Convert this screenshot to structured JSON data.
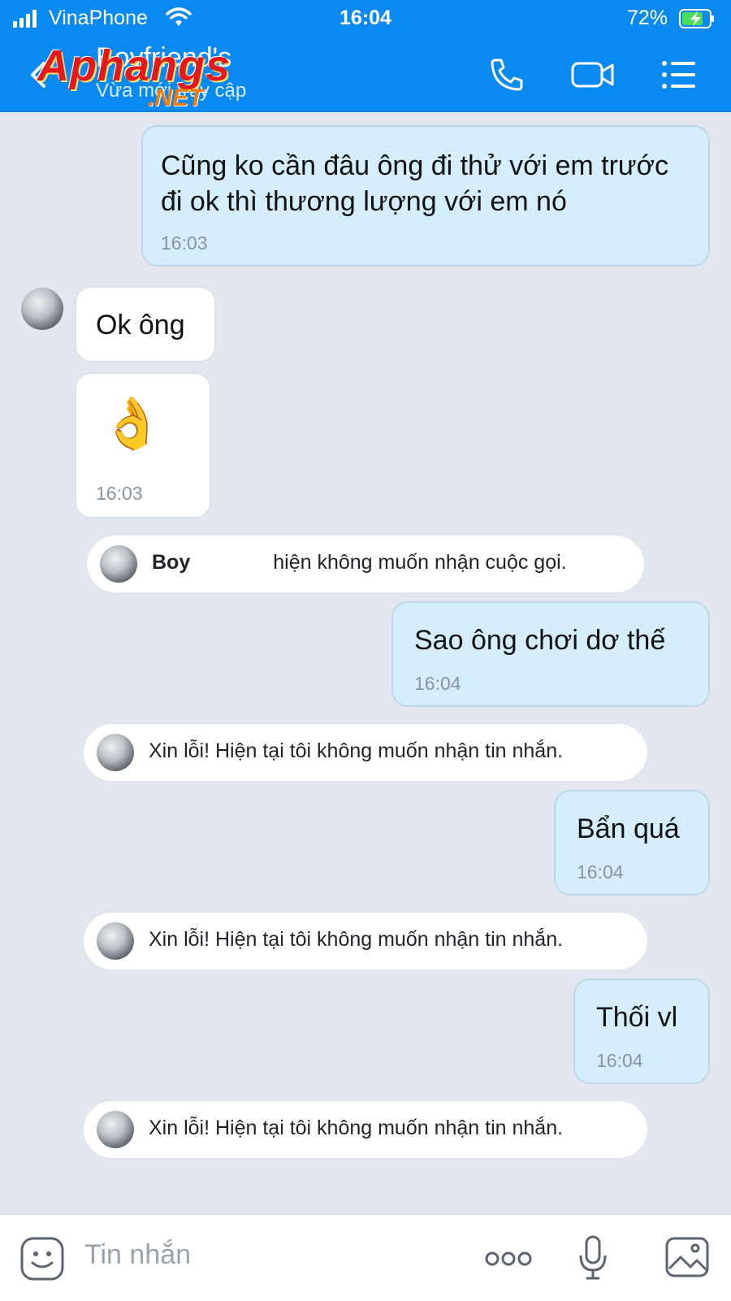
{
  "status_bar": {
    "carrier": "VinaPhone",
    "time": "16:04",
    "battery": "72%"
  },
  "header": {
    "title": "Boyfriend's",
    "subtitle": "Vừa mới truy cập"
  },
  "watermark": {
    "main": "Aphangs",
    "suffix": ".NET"
  },
  "messages": [
    {
      "text": "Cũng ko cần đâu ông đi thử với em trước đi ok thì thương lượng với em nó",
      "time": "16:03"
    },
    {
      "text": "Ok ông"
    },
    {
      "text": "👌",
      "time": "16:03"
    },
    {
      "text": "Sao ông chơi dơ thế",
      "time": "16:04"
    },
    {
      "text": "Bẩn quá",
      "time": "16:04"
    },
    {
      "text": "Thối vl",
      "time": "16:04"
    }
  ],
  "notices": [
    {
      "name": "Boy",
      "text": "hiện không muốn nhận cuộc gọi."
    },
    {
      "text": "Xin lỗi! Hiện tại tôi không muốn nhận tin nhắn."
    },
    {
      "text": "Xin lỗi! Hiện tại tôi không muốn nhận tin nhắn."
    },
    {
      "text": "Xin lỗi! Hiện tại tôi không muốn nhận tin nhắn."
    }
  ],
  "composer": {
    "placeholder": "Tin nhắn"
  },
  "icons": {
    "back": "chevron-left-icon",
    "call": "phone-icon",
    "video": "video-camera-icon",
    "menu": "list-menu-icon",
    "sticker": "smiley-sticker-icon",
    "more": "more-dots-icon",
    "mic": "microphone-icon",
    "image": "image-gallery-icon"
  },
  "colors": {
    "header": "#0a8af0",
    "outgoing_bubble": "#d4eefe",
    "chat_bg": "#e3e8f0"
  }
}
